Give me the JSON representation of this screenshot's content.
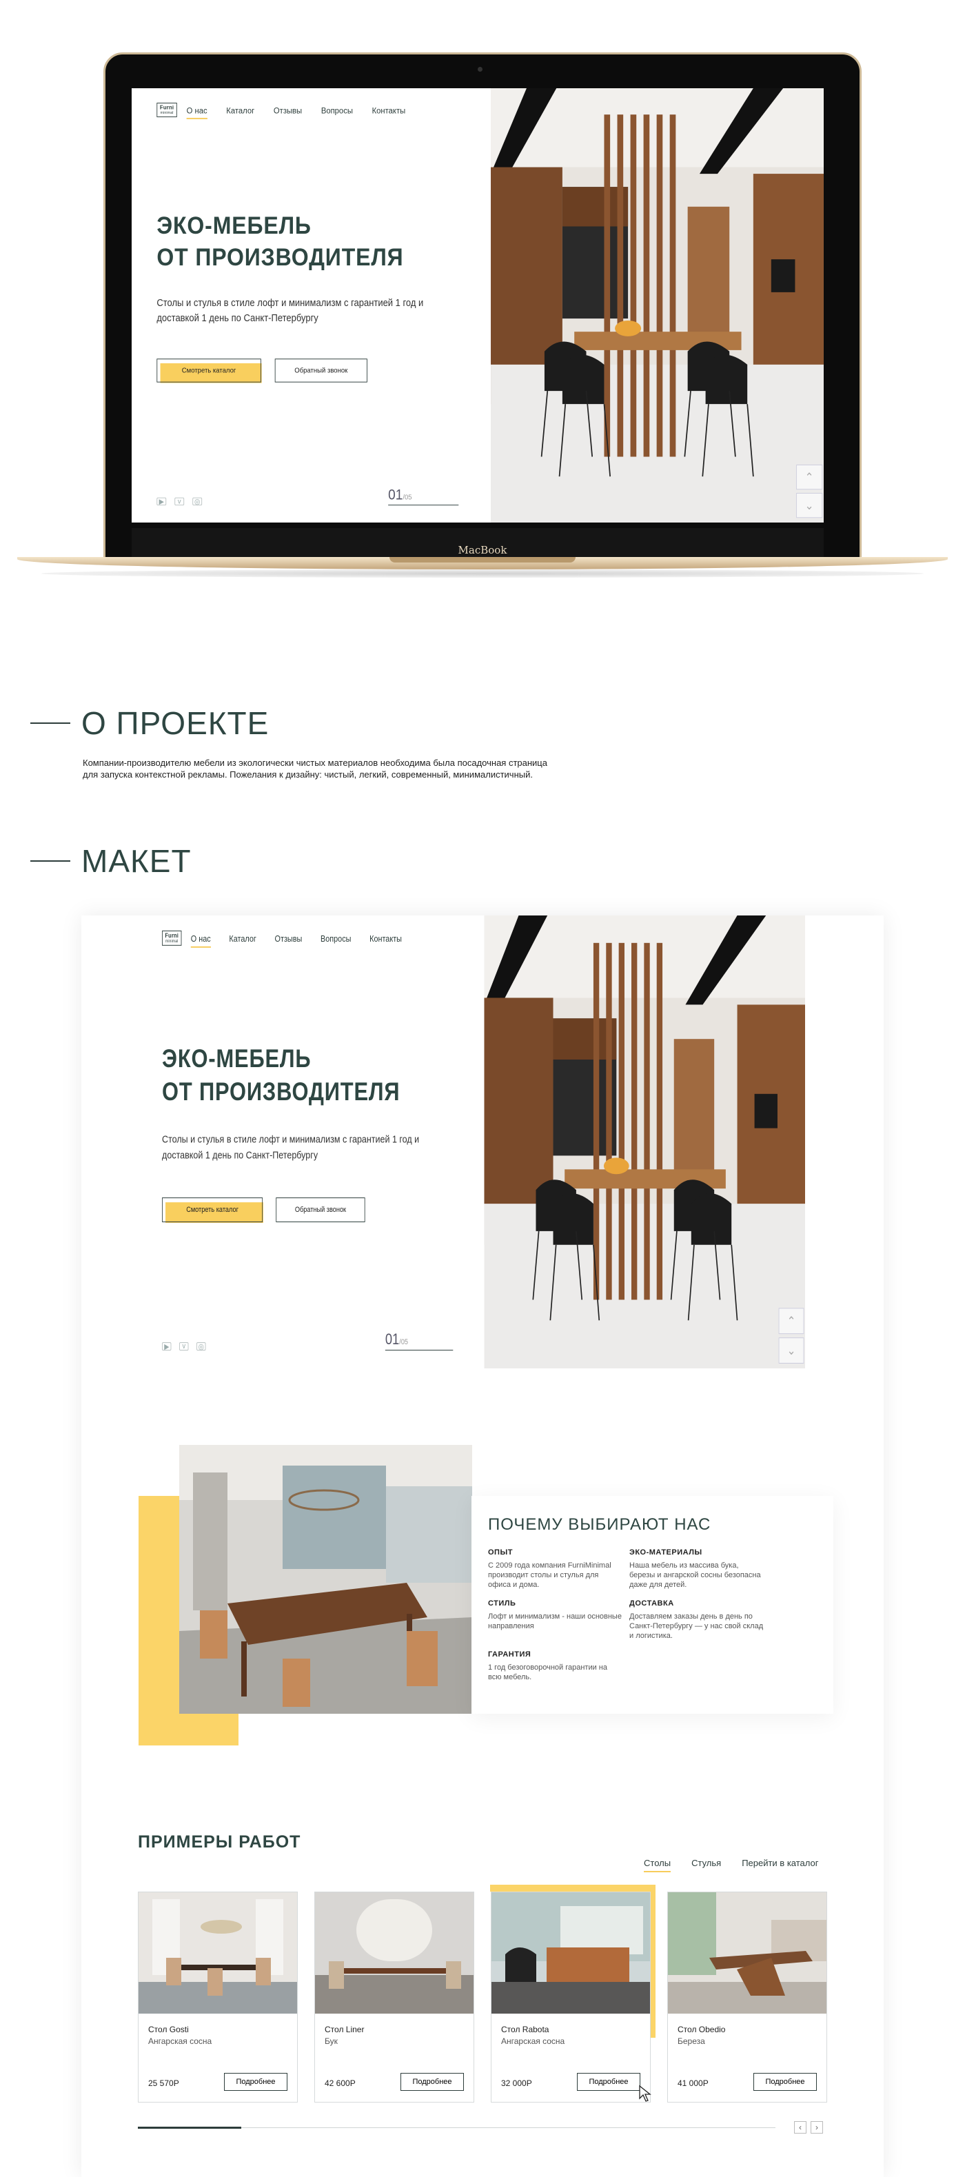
{
  "laptop": {
    "brand": "MacBook"
  },
  "hero": {
    "logo": {
      "main": "Furni",
      "sub": "minimal"
    },
    "nav": [
      "О нас",
      "Каталог",
      "Отзывы",
      "Вопросы",
      "Контакты"
    ],
    "title_line1": "ЭКО-МЕБЕЛЬ",
    "title_line2": "ОТ ПРОИЗВОДИТЕЛЯ",
    "subtitle": "Столы и стулья в стиле лофт и минимализм с гарантией 1 год и доставкой 1 день по Санкт-Петербургу",
    "primary_button": "Смотреть каталог",
    "secondary_button": "Обратный звонок",
    "counter_current": "01",
    "counter_total": "/05",
    "social_icons": [
      "youtube-icon",
      "vk-icon",
      "instagram-icon"
    ],
    "arrow_up": "⌃",
    "arrow_down": "⌄"
  },
  "about": {
    "heading": "О ПРОЕКТЕ",
    "text": "Компании-производителю мебели из экологически чистых материалов необходима была посадочная страница для запуска контекстной рекламы. Пожелания к дизайну: чистый, легкий, современный, минималистичный."
  },
  "maket": {
    "heading": "МАКЕТ"
  },
  "why": {
    "title": "ПОЧЕМУ ВЫБИРАЮТ НАС",
    "items": [
      {
        "title": "ОПЫТ",
        "text": "С 2009 года компания FurniMinimal производит столы и стулья для офиса и дома."
      },
      {
        "title": "ЭКО-МАТЕРИАЛЫ",
        "text": "Наша мебель из массива бука, березы и ангарской сосны безопасна даже для детей."
      },
      {
        "title": "СТИЛЬ",
        "text": "Лофт и минимализм - наши основные направления"
      },
      {
        "title": "ДОСТАВКА",
        "text": "Доставляем заказы день в день по Санкт-Петербургу — у нас свой склад и логистика."
      },
      {
        "title": "ГАРАНТИЯ",
        "text": "1 год безоговорочной гарантии на всю мебель."
      }
    ]
  },
  "works": {
    "title": "ПРИМЕРЫ РАБОТ",
    "tabs": [
      "Столы",
      "Стулья",
      "Перейти в каталог"
    ],
    "cards": [
      {
        "name": "Стол Gosti",
        "material": "Ангарская сосна",
        "price": "25 570Р",
        "button": "Подробнее"
      },
      {
        "name": "Стол Liner",
        "material": "Бук",
        "price": "42 600Р",
        "button": "Подробнее"
      },
      {
        "name": "Стол Rabota",
        "material": "Ангарская сосна",
        "price": "32 000Р",
        "button": "Подробнее"
      },
      {
        "name": "Стол Obedio",
        "material": "Береза",
        "price": "41 000Р",
        "button": "Подробнее"
      }
    ],
    "pager_prev": "‹",
    "pager_next": "›"
  },
  "colors": {
    "accent": "#fbd468",
    "text": "#2e4642",
    "laptop_gold": "#cdb996"
  }
}
